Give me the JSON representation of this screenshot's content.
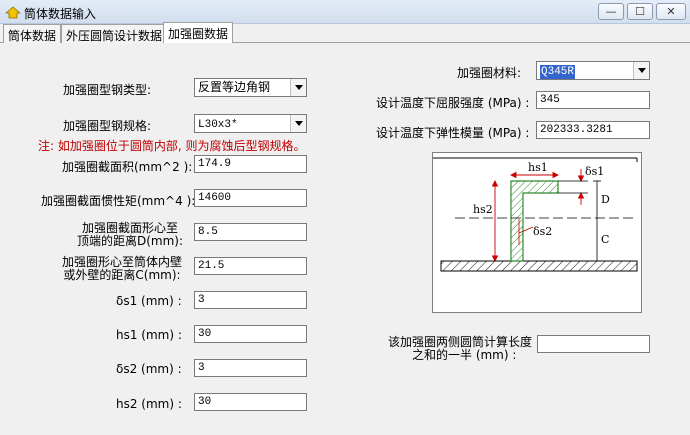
{
  "window": {
    "title": "筒体数据输入",
    "min_glyph": "—",
    "max_glyph": "☐",
    "close_glyph": "✕"
  },
  "tabs": [
    {
      "label": "筒体数据"
    },
    {
      "label": "外压圆筒设计数据"
    },
    {
      "label": "加强圈数据"
    }
  ],
  "form": {
    "steel_type_label": "加强圈型钢类型:",
    "steel_type_value": "反置等边角钢",
    "steel_spec_label": "加强圈型钢规格:",
    "steel_spec_value": "L30x3*",
    "note": "注: 如加强圈位于圆筒内部, 则为腐蚀后型钢规格。",
    "area_label": "加强圈截面积(mm^2 ):",
    "area_value": "174.9",
    "inertia_label": "加强圈截面惯性矩(mm^4 ):",
    "inertia_value": "14600",
    "d_label_1": "加强圈截面形心至",
    "d_label_2": "顶端的距离D(mm):",
    "d_value": "8.5",
    "c_label_1": "加强圈形心至筒体内壁",
    "c_label_2": "或外壁的距离C(mm):",
    "c_value": "21.5",
    "ds1_label": "δs1 (mm) :",
    "ds1_value": "3",
    "hs1_label": "hs1 (mm) :",
    "hs1_value": "30",
    "ds2_label": "δs2 (mm) :",
    "ds2_value": "3",
    "hs2_label": "hs2 (mm) :",
    "hs2_value": "30"
  },
  "material": {
    "label": "加强圈材料:",
    "value": "Q345R",
    "yield_label": "设计温度下屈服强度 (MPa) :",
    "yield_value": "345",
    "modulus_label": "设计温度下弹性模量 (MPa) :",
    "modulus_value": "202333.3281"
  },
  "length": {
    "label_1": "该加强圈两侧圆筒计算长度",
    "label_2": "之和的一半 (mm) :",
    "value": ""
  },
  "diagram": {
    "hs1": "hs1",
    "ds1": "δs1",
    "hs2": "hs2",
    "ds2": "δs2",
    "d": "D",
    "c": "C"
  },
  "colors": {
    "note": "#c00000",
    "hatch": "#2e8b2e",
    "dim": "#cc0000",
    "selection": "#3366cc"
  }
}
